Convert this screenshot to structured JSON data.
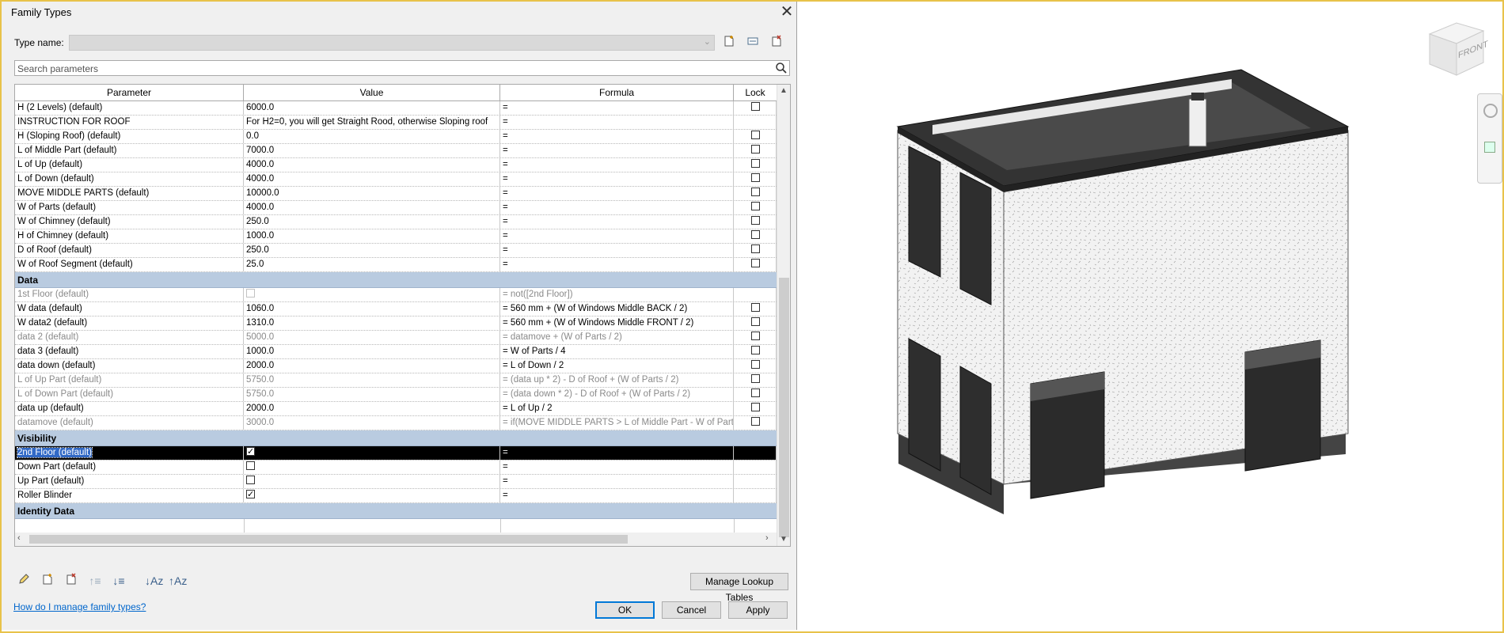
{
  "dialog": {
    "title": "Family Types",
    "type_name_label": "Type name:",
    "type_name_value": "",
    "search_placeholder": "Search parameters",
    "help_link": "How do I manage family types?",
    "buttons": {
      "manage": "Manage Lookup Tables",
      "ok": "OK",
      "cancel": "Cancel",
      "apply": "Apply"
    }
  },
  "columns": {
    "parameter": "Parameter",
    "value": "Value",
    "formula": "Formula",
    "lock": "Lock"
  },
  "groups": {
    "dimensions_rows": [
      {
        "p": "H (2 Levels) (default)",
        "v": "6000.0",
        "f": "=",
        "lock": true
      },
      {
        "p": "INSTRUCTION FOR ROOF",
        "v": "For H2=0, you will get Straight Rood, otherwise Sloping roof",
        "f": "=",
        "lock": false
      },
      {
        "p": "H (Sloping Roof) (default)",
        "v": "0.0",
        "f": "=",
        "lock": true
      },
      {
        "p": "L of Middle Part (default)",
        "v": "7000.0",
        "f": "=",
        "lock": true
      },
      {
        "p": "L of Up (default)",
        "v": "4000.0",
        "f": "=",
        "lock": true
      },
      {
        "p": "L of Down (default)",
        "v": "4000.0",
        "f": "=",
        "lock": true
      },
      {
        "p": "MOVE MIDDLE PARTS (default)",
        "v": "10000.0",
        "f": "=",
        "lock": true
      },
      {
        "p": "W of Parts (default)",
        "v": "4000.0",
        "f": "=",
        "lock": true
      },
      {
        "p": "W of Chimney (default)",
        "v": "250.0",
        "f": "=",
        "lock": true
      },
      {
        "p": "H of Chimney (default)",
        "v": "1000.0",
        "f": "=",
        "lock": true
      },
      {
        "p": "D of Roof (default)",
        "v": "250.0",
        "f": "=",
        "lock": true
      },
      {
        "p": "W of Roof Segment (default)",
        "v": "25.0",
        "f": "=",
        "lock": true
      }
    ],
    "data_title": "Data",
    "data_rows": [
      {
        "p": "1st Floor (default)",
        "v": "",
        "checkbox": "disabled",
        "f": "= not([2nd Floor])",
        "lock": false,
        "dim": true
      },
      {
        "p": "W data (default)",
        "v": "1060.0",
        "f": "= 560 mm + (W of Windows Middle BACK / 2)",
        "lock": true,
        "dim": false
      },
      {
        "p": "W data2 (default)",
        "v": "1310.0",
        "f": "= 560 mm + (W of Windows Middle FRONT / 2)",
        "lock": true,
        "dim": false
      },
      {
        "p": "data 2 (default)",
        "v": "5000.0",
        "f": "= datamove + (W of Parts / 2)",
        "lock": true,
        "dim": true
      },
      {
        "p": "data 3 (default)",
        "v": "1000.0",
        "f": "= W of Parts / 4",
        "lock": true,
        "dim": false
      },
      {
        "p": "data down (default)",
        "v": "2000.0",
        "f": "= L of Down / 2",
        "lock": true,
        "dim": false
      },
      {
        "p": "L of Up Part (default)",
        "v": "5750.0",
        "f": "= (data up * 2) - D of Roof + (W of Parts / 2)",
        "lock": true,
        "dim": true
      },
      {
        "p": "L of Down Part (default)",
        "v": "5750.0",
        "f": "= (data down * 2) - D of Roof + (W of Parts / 2)",
        "lock": true,
        "dim": true
      },
      {
        "p": "data up (default)",
        "v": "2000.0",
        "f": "= L of Up / 2",
        "lock": true,
        "dim": false
      },
      {
        "p": "datamove (default)",
        "v": "3000.0",
        "f": "= if(MOVE MIDDLE PARTS > L of Middle Part - W of Part",
        "lock": true,
        "dim": true
      }
    ],
    "visibility_title": "Visibility",
    "visibility_rows": [
      {
        "p": "2nd Floor (default)",
        "checked": true,
        "f": "=",
        "selected": true
      },
      {
        "p": "Down Part (default)",
        "checked": false,
        "f": "=",
        "selected": false
      },
      {
        "p": "Up Part (default)",
        "checked": false,
        "f": "=",
        "selected": false
      },
      {
        "p": "Roller Blinder",
        "checked": true,
        "f": "=",
        "selected": false
      }
    ],
    "identity_title": "Identity Data"
  },
  "viewcube": {
    "label": "FRONT"
  },
  "colors": {
    "group_header": "#b9cbe0",
    "link": "#0066cc",
    "frame": "#e8c24a"
  }
}
